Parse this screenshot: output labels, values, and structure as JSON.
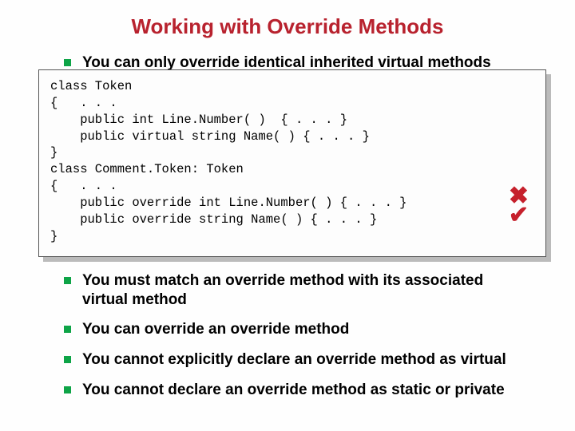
{
  "title": "Working with Override Methods",
  "bullets_top": [
    "You can only override identical inherited virtual methods"
  ],
  "code": "class Token\n{   . . .\n    public int Line.Number( )  { . . . }\n    public virtual string Name( ) { . . . }\n}\nclass Comment.Token: Token\n{   . . .\n    public override int Line.Number( ) { . . . }\n    public override string Name( ) { . . . }\n}",
  "marks": {
    "cross": "✖",
    "check": "✔"
  },
  "bullets_bottom": [
    "You must match an override method with its associated virtual method",
    "You can override an override method",
    "You cannot explicitly declare an override method as virtual",
    "You cannot declare an override method as static or private"
  ]
}
